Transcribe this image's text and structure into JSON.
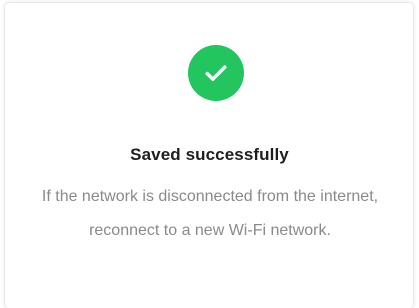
{
  "dialog": {
    "icon": "check-circle-icon",
    "icon_color": "#22c55e",
    "title": "Saved successfully",
    "message": "If the network is disconnected from the internet, reconnect to a new Wi-Fi network."
  }
}
